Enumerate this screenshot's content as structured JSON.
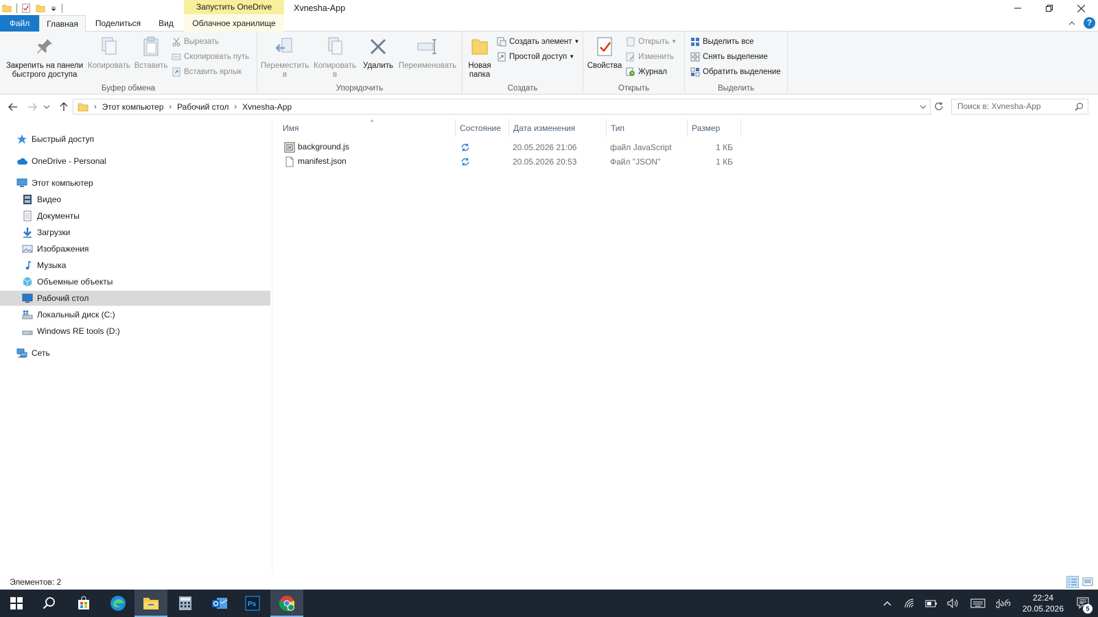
{
  "window": {
    "title": "Xvnesha-App",
    "context_tab_header": "Запустить OneDrive"
  },
  "tabs": {
    "file": "Файл",
    "home": "Главная",
    "share": "Поделиться",
    "view": "Вид",
    "cloud": "Облачное хранилище"
  },
  "ribbon": {
    "clipboard": {
      "label": "Буфер обмена",
      "pin_line1": "Закрепить на панели",
      "pin_line2": "быстрого доступа",
      "copy": "Копировать",
      "paste": "Вставить",
      "cut": "Вырезать",
      "copy_path": "Скопировать путь",
      "paste_shortcut": "Вставить ярлык"
    },
    "organize": {
      "label": "Упорядочить",
      "move_line1": "Переместить",
      "move_line2": "в",
      "copy_line1": "Копировать",
      "copy_line2": "в",
      "delete": "Удалить",
      "rename": "Переименовать"
    },
    "new": {
      "label": "Создать",
      "new_folder_line1": "Новая",
      "new_folder_line2": "папка",
      "new_item": "Создать элемент",
      "easy_access": "Простой доступ"
    },
    "open": {
      "label": "Открыть",
      "properties": "Свойства",
      "open": "Открыть",
      "edit": "Изменить",
      "history": "Журнал"
    },
    "select": {
      "label": "Выделить",
      "select_all": "Выделить все",
      "select_none": "Снять выделение",
      "invert": "Обратить выделение"
    }
  },
  "address": {
    "crumbs": [
      "Этот компьютер",
      "Рабочий стол",
      "Xvnesha-App"
    ],
    "search_placeholder": "Поиск в: Xvnesha-App"
  },
  "nav": {
    "quick_access": "Быстрый доступ",
    "onedrive": "OneDrive - Personal",
    "this_pc": "Этот компьютер",
    "items": [
      "Видео",
      "Документы",
      "Загрузки",
      "Изображения",
      "Музыка",
      "Объемные объекты",
      "Рабочий стол",
      "Локальный диск (C:)",
      "Windows RE tools (D:)"
    ],
    "network": "Сеть",
    "selected": "Рабочий стол"
  },
  "columns": {
    "name": "Имя",
    "status": "Состояние",
    "date": "Дата изменения",
    "type": "Тип",
    "size": "Размер"
  },
  "files": [
    {
      "name": "background.js",
      "date": "20.05.2026 21:06",
      "type": "файл JavaScript",
      "size": "1 КБ",
      "icon": "js-file-icon"
    },
    {
      "name": "manifest.json",
      "date": "20.05.2026 20:53",
      "type": "Файл \"JSON\"",
      "size": "1 КБ",
      "icon": "json-file-icon"
    }
  ],
  "status": {
    "count_text": "Элементов: 2"
  },
  "taskbar": {
    "time": "22:24",
    "date": "20.05.2026",
    "language": "ქარ",
    "notifications": "5"
  },
  "colors": {
    "file_tab": "#1979ca",
    "context_tab": "#f8ef9d",
    "selected_nav": "#d9d9d9",
    "taskbar": "#1c2530"
  }
}
